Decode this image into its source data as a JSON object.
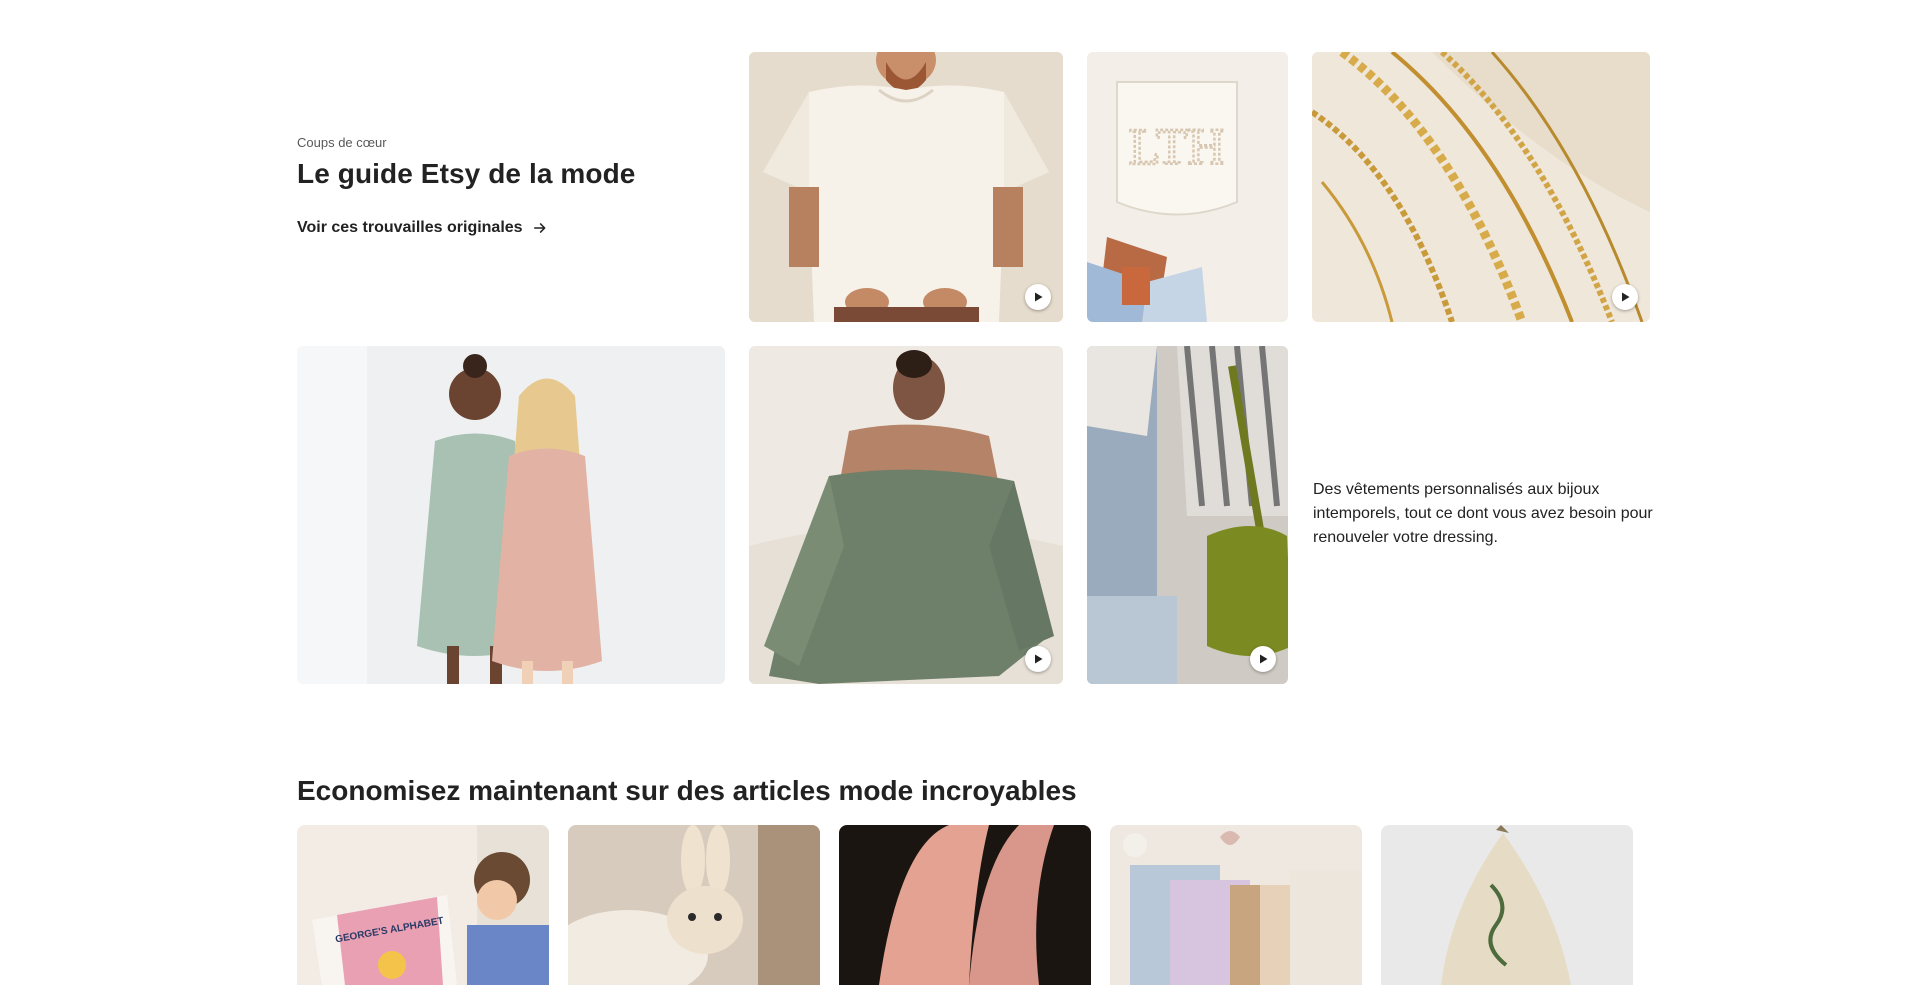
{
  "editors_picks": {
    "eyebrow": "Coups de cœur",
    "title": "Le guide Etsy de la mode",
    "cta_label": "Voir ces trouvailles originales",
    "description": "Des vêtements personnalisés aux bijoux intemporels, tout ce dont vous avez besoin pour renouveler votre dressing.",
    "tiles": [
      {
        "subject": "linen-shirt",
        "has_video": true
      },
      {
        "subject": "embroidered-pocket-LTH",
        "has_video": false
      },
      {
        "subject": "gold-chains",
        "has_video": true
      },
      {
        "subject": "kids-linen-dresses",
        "has_video": false
      },
      {
        "subject": "green-off-shoulder-blouse",
        "has_video": true
      },
      {
        "subject": "olive-bucket-bag",
        "has_video": true
      }
    ],
    "pocket_monogram": "LTH"
  },
  "deals": {
    "title": "Economisez maintenant sur des articles mode incroyables",
    "cards": [
      {
        "subject": "alphabet-book",
        "book_text": "GEORGE'S ALPHABET"
      },
      {
        "subject": "crochet-bunny"
      },
      {
        "subject": "ring-hand"
      },
      {
        "subject": "craft-supplies"
      },
      {
        "subject": "felt-hat"
      }
    ]
  },
  "icons": {
    "arrow": "arrow-right-icon",
    "play": "play-icon"
  }
}
